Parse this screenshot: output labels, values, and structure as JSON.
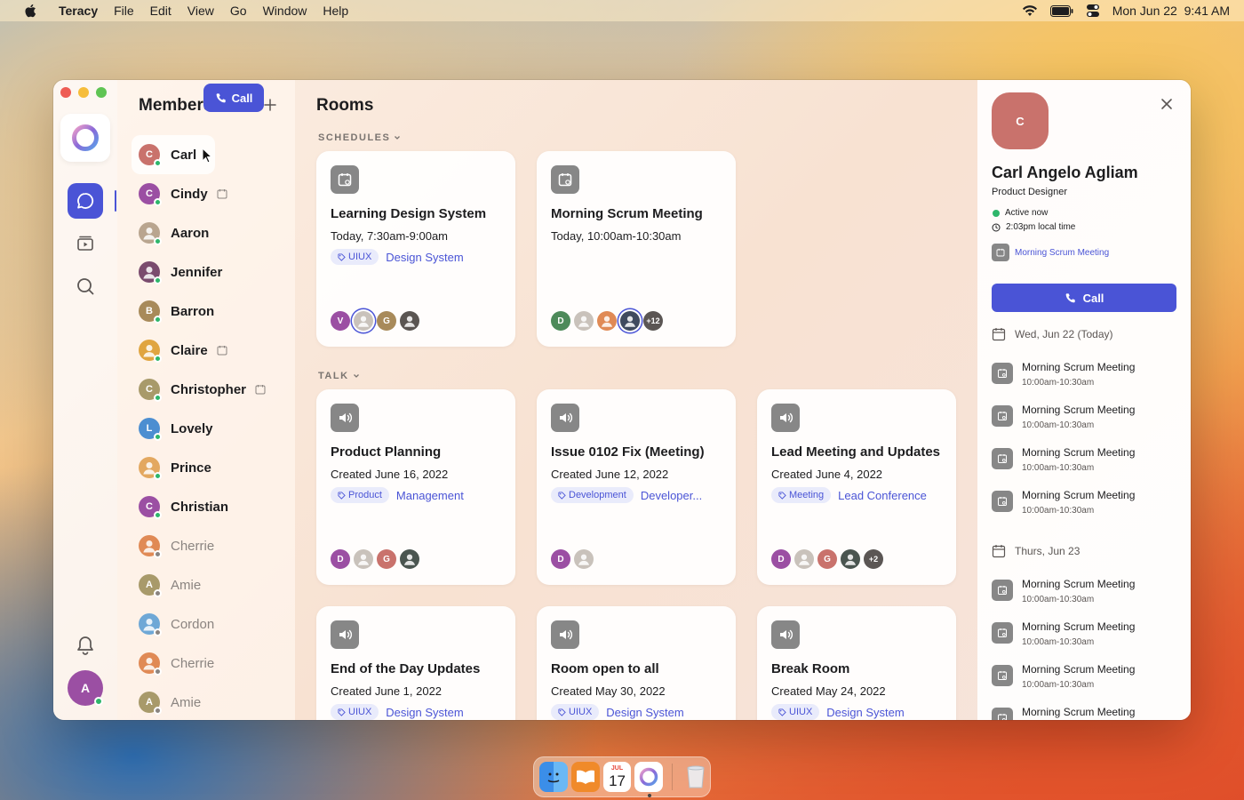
{
  "menubar": {
    "app_name": "Teracy",
    "items": [
      "File",
      "Edit",
      "View",
      "Go",
      "Window",
      "Help"
    ],
    "clock": "Mon Jun 22  9:41 AM"
  },
  "members": {
    "title": "Members",
    "call_label": "Call",
    "list": [
      {
        "initial": "C",
        "name": "Carl",
        "color": "#c9726c",
        "status": "online"
      },
      {
        "initial": "C",
        "name": "Cindy",
        "color": "#9b4fa3",
        "status": "online",
        "meeting": true
      },
      {
        "initial": "",
        "name": "Aaron",
        "color": "#b9a58f",
        "status": "busy"
      },
      {
        "initial": "",
        "name": "Jennifer",
        "color": "#7a4b6e",
        "status": "online"
      },
      {
        "initial": "B",
        "name": "Barron",
        "color": "#a88a5a",
        "status": "away"
      },
      {
        "initial": "",
        "name": "Claire",
        "color": "#e0a540",
        "status": "online",
        "meeting": true
      },
      {
        "initial": "C",
        "name": "Christopher",
        "color": "#a89a6a",
        "status": "online",
        "meeting": true
      },
      {
        "initial": "L",
        "name": "Lovely",
        "color": "#4c8ed1",
        "status": "online"
      },
      {
        "initial": "",
        "name": "Prince",
        "color": "#e3a860",
        "status": "busy"
      },
      {
        "initial": "C",
        "name": "Christian",
        "color": "#9b4fa3",
        "status": "away"
      },
      {
        "initial": "",
        "name": "Cherrie",
        "color": "#e08a55",
        "status": "offline"
      },
      {
        "initial": "A",
        "name": "Amie",
        "color": "#a89a6a",
        "status": "offline"
      },
      {
        "initial": "",
        "name": "Cordon",
        "color": "#6fa8d6",
        "status": "offline"
      },
      {
        "initial": "",
        "name": "Cherrie",
        "color": "#e08a55",
        "status": "offline"
      },
      {
        "initial": "A",
        "name": "Amie",
        "color": "#a89a6a",
        "status": "offline"
      }
    ]
  },
  "rooms": {
    "title": "Rooms",
    "schedules_label": "SCHEDULES",
    "talk_label": "TALK",
    "schedules": [
      {
        "title": "Learning Design System",
        "subtitle": "Today, 7:30am-9:00am",
        "tag": "UIUX",
        "link": "Design System",
        "avatars": [
          {
            "l": "V",
            "c": "#9b4fa3"
          },
          {
            "l": "",
            "c": "#c9c2bb",
            "ring": true
          },
          {
            "l": "G",
            "c": "#a88a5a"
          },
          {
            "l": "",
            "c": "#5a5552"
          }
        ]
      },
      {
        "title": "Morning Scrum Meeting",
        "subtitle": "Today, 10:00am-10:30am",
        "tag": "",
        "link": "",
        "avatars": [
          {
            "l": "D",
            "c": "#4d8a5a"
          },
          {
            "l": "",
            "c": "#c9c2bb"
          },
          {
            "l": "",
            "c": "#e08a55"
          },
          {
            "l": "",
            "c": "#3f4a5e",
            "ring": true
          },
          {
            "l": "+12",
            "c": "#5b5654"
          }
        ]
      }
    ],
    "talks": [
      {
        "title": "Product Planning",
        "subtitle": "Created June 16, 2022",
        "tag": "Product",
        "link": "Management",
        "avatars": [
          {
            "l": "D",
            "c": "#9b4fa3"
          },
          {
            "l": "",
            "c": "#c9c2bb"
          },
          {
            "l": "G",
            "c": "#c9726c"
          },
          {
            "l": "",
            "c": "#4a5550"
          }
        ]
      },
      {
        "title": "Issue 0102 Fix (Meeting)",
        "subtitle": "Created June 12, 2022",
        "tag": "Development",
        "link": "Developer...",
        "avatars": [
          {
            "l": "D",
            "c": "#9b4fa3"
          },
          {
            "l": "",
            "c": "#c9c2bb"
          }
        ]
      },
      {
        "title": "Lead Meeting and Updates",
        "subtitle": "Created June 4, 2022",
        "tag": "Meeting",
        "link": "Lead Conference",
        "avatars": [
          {
            "l": "D",
            "c": "#9b4fa3"
          },
          {
            "l": "",
            "c": "#c9c2bb"
          },
          {
            "l": "G",
            "c": "#c9726c"
          },
          {
            "l": "",
            "c": "#4a5550"
          },
          {
            "l": "+2",
            "c": "#5b5654"
          }
        ]
      },
      {
        "title": "End of the Day Updates",
        "subtitle": "Created June 1, 2022",
        "tag": "UIUX",
        "link": "Design System",
        "avatars": []
      },
      {
        "title": "Room open to all",
        "subtitle": "Created May 30, 2022",
        "tag": "UIUX",
        "link": "Design System",
        "avatars": []
      },
      {
        "title": "Break Room",
        "subtitle": "Created May 24, 2022",
        "tag": "UIUX",
        "link": "Design System",
        "avatars": []
      }
    ]
  },
  "profile": {
    "initial": "C",
    "name": "Carl Angelo Agliam",
    "role": "Product Designer",
    "status": "Active now",
    "local_time": "2:03pm local time",
    "current_meeting": "Morning Scrum Meeting",
    "call_label": "Call",
    "days": [
      {
        "label": "Wed, Jun 22 (Today)",
        "events": [
          {
            "title": "Morning Scrum Meeting",
            "time": "10:00am-10:30am"
          },
          {
            "title": "Morning Scrum Meeting",
            "time": "10:00am-10:30am"
          },
          {
            "title": "Morning Scrum Meeting",
            "time": "10:00am-10:30am"
          },
          {
            "title": "Morning Scrum Meeting",
            "time": "10:00am-10:30am"
          }
        ]
      },
      {
        "label": "Thurs, Jun 23",
        "events": [
          {
            "title": "Morning Scrum Meeting",
            "time": "10:00am-10:30am"
          },
          {
            "title": "Morning Scrum Meeting",
            "time": "10:00am-10:30am"
          },
          {
            "title": "Morning Scrum Meeting",
            "time": "10:00am-10:30am"
          },
          {
            "title": "Morning Scrum Meeting",
            "time": ""
          }
        ]
      }
    ]
  },
  "dock": {
    "calendar_month": "JUL",
    "calendar_day": "17"
  },
  "colors": {
    "accent": "#4a54d6",
    "online": "#2eb66b",
    "away": "#2eb66b",
    "busy": "#2eb66b",
    "offline": "#8a8480"
  }
}
